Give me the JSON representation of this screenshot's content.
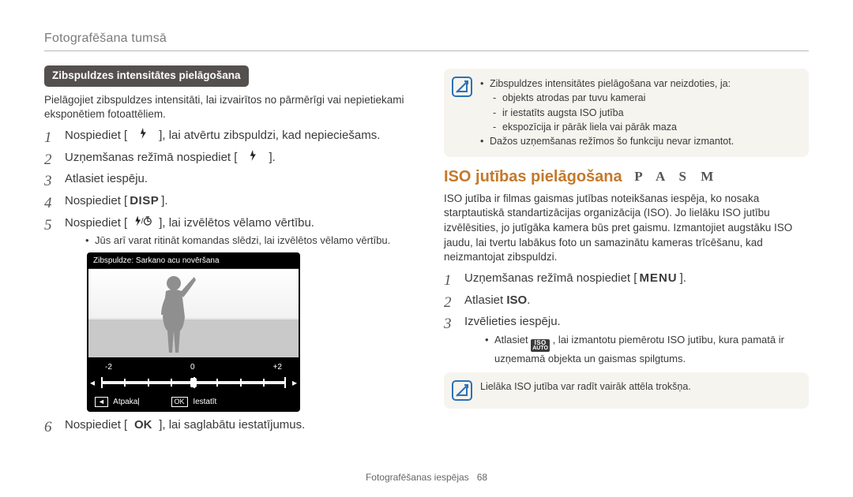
{
  "header": "Fotografēšana tumsā",
  "footer": {
    "label": "Fotografēšanas iespējas",
    "page": "68"
  },
  "left": {
    "section_pill": "Zibspuldzes intensitātes pielāgošana",
    "intro": "Pielāgojiet zibspuldzes intensitāti, lai izvairītos no pārmērīgi vai nepietiekami eksponētiem fotoattēliem.",
    "steps": {
      "s1a": "Nospiediet [",
      "s1b": "], lai atvērtu zibspuldzi, kad nepieciešams.",
      "s2a": "Uzņemšanas režīmā nospiediet [",
      "s2b": "].",
      "s3": "Atlasiet iespēju.",
      "s4a": "Nospiediet [",
      "s4b": "].",
      "s5a": "Nospiediet [",
      "s5b": "], lai izvēlētos vēlamo vērtību.",
      "s5_sub": "Jūs arī varat ritināt komandas slēdzi, lai izvēlētos vēlamo vērtību.",
      "s6a": "Nospiediet [",
      "s6b": "], lai saglabātu iestatījumus."
    },
    "keys": {
      "disp": "DISP",
      "ok": "OK"
    },
    "cam": {
      "title": "Zibspuldze: Sarkano acu novēršana",
      "labels": [
        "-2",
        "0",
        "+2"
      ],
      "back": "Atpakaļ",
      "set": "Iestatīt",
      "back_key": "◄",
      "set_key": "OK"
    }
  },
  "right": {
    "note1": {
      "line1": "Zibspuldzes intensitātes pielāgošana var neizdoties, ja:",
      "sub1": "objekts atrodas par tuvu kamerai",
      "sub2": "ir iestatīts augsta ISO jutība",
      "sub3": "ekspozīcija ir pārāk liela vai pārāk maza",
      "line2": "Dažos uzņemšanas režīmos šo funkciju nevar izmantot."
    },
    "heading": "ISO jutības pielāgošana",
    "modes": "P A S M",
    "intro": "ISO jutība ir filmas gaismas jutības noteikšanas iespēja, ko nosaka starptautiskā standartizācijas organizācija (ISO). Jo lielāku ISO jutību izvēlēsities, jo jutīgāka kamera būs pret gaismu. Izmantojiet augstāku ISO jaudu, lai tvertu labākus foto un samazinātu kameras trīcēšanu, kad neizmantojat zibspuldzi.",
    "steps": {
      "s1a": "Uzņemšanas režīmā nospiediet [",
      "s1b": "].",
      "s2a": "Atlasiet ",
      "s2b": "ISO",
      "s2c": ".",
      "s3": "Izvēlieties iespēju.",
      "s3_sub_a": "Atlasiet ",
      "s3_sub_b": ", lai izmantotu piemērotu ISO jutību, kura pamatā ir uzņemamā objekta un gaismas spilgtums."
    },
    "keys": {
      "menu": "MENU"
    },
    "note2": "Lielāka ISO jutība var radīt vairāk attēla trokšņa.",
    "auto_iso": {
      "top": "ISO",
      "bot": "AUTO"
    }
  }
}
